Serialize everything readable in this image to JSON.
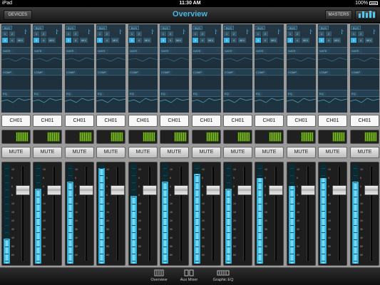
{
  "status": {
    "device": "iPad",
    "time": "11:30 AM",
    "battery": "100%"
  },
  "header": {
    "title": "Overview",
    "devices_label": "DEVICES",
    "masters_label": "MASTERS"
  },
  "strip_labels": {
    "bus": [
      "BUS",
      "1",
      "2",
      "3",
      "4",
      "MIX"
    ],
    "gate": "GATE",
    "comp": "COMP",
    "eq": "EQ"
  },
  "channels": [
    {
      "name": "CH01",
      "mute": "MUTE",
      "level": 0.25
    },
    {
      "name": "CH01",
      "mute": "MUTE",
      "level": 0.75
    },
    {
      "name": "CH01",
      "mute": "MUTE",
      "level": 0.82
    },
    {
      "name": "CH01",
      "mute": "MUTE",
      "level": 0.96
    },
    {
      "name": "CH01",
      "mute": "MUTE",
      "level": 0.68
    },
    {
      "name": "CH01",
      "mute": "MUTE",
      "level": 0.82
    },
    {
      "name": "CH01",
      "mute": "MUTE",
      "level": 0.9
    },
    {
      "name": "CH01",
      "mute": "MUTE",
      "level": 0.75
    },
    {
      "name": "CH01",
      "mute": "MUTE",
      "level": 0.86
    },
    {
      "name": "CH01",
      "mute": "MUTE",
      "level": 0.78
    },
    {
      "name": "CH01",
      "mute": "MUTE",
      "level": 0.86
    },
    {
      "name": "CH01",
      "mute": "MUTE",
      "level": 0.82
    }
  ],
  "fader_scale": [
    "10",
    "5",
    "0",
    "5",
    "10",
    "15",
    "20",
    "30",
    "40",
    "50",
    "60"
  ],
  "tabs": [
    {
      "label": "Overview",
      "icon": "overview-icon"
    },
    {
      "label": "Aux Mixer",
      "icon": "aux-mixer-icon"
    },
    {
      "label": "Graphic EQ",
      "icon": "graphic-eq-icon"
    }
  ]
}
